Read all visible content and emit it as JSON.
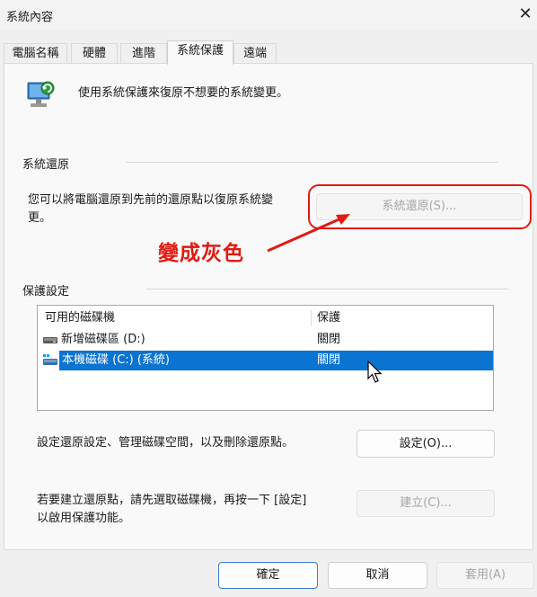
{
  "window": {
    "title": "系統內容",
    "close_glyph": "✕"
  },
  "tabs": [
    {
      "label": "電腦名稱"
    },
    {
      "label": "硬體"
    },
    {
      "label": "進階"
    },
    {
      "label": "系統保護",
      "active": true
    },
    {
      "label": "遠端"
    }
  ],
  "intro": {
    "text": "使用系統保護來復原不想要的系統變更。",
    "icon": "system-protection-icon"
  },
  "restore": {
    "group_label": "系統還原",
    "description_line1": "您可以將電腦還原到先前的還原點以復原系統變",
    "description_line2": "更。",
    "button_label": "系統還原(S)..."
  },
  "annotation": {
    "text": "變成灰色",
    "color": "#e01b12"
  },
  "protection": {
    "group_label": "保護設定",
    "columns": [
      "可用的磁碟機",
      "保護"
    ],
    "drives": [
      {
        "name": "新增磁碟區 (D:)",
        "protection": "關閉",
        "icon": "drive-icon"
      },
      {
        "name": "本機磁碟 (C:) (系統)",
        "protection": "關閉",
        "icon": "system-drive-icon",
        "selected": true
      }
    ]
  },
  "configure": {
    "text": "設定還原設定、管理磁碟空間，以及刪除還原點。",
    "button_label": "設定(O)..."
  },
  "create": {
    "text_line1": "若要建立還原點，請先選取磁碟機，再按一下 [設定]",
    "text_line2": "以啟用保護功能。",
    "button_label": "建立(C)..."
  },
  "footer": {
    "ok_label": "確定",
    "cancel_label": "取消",
    "apply_label": "套用(A)"
  },
  "colors": {
    "selection": "#0b73d1",
    "annotation": "#e01b12",
    "primary_border": "#3c7cc8"
  }
}
